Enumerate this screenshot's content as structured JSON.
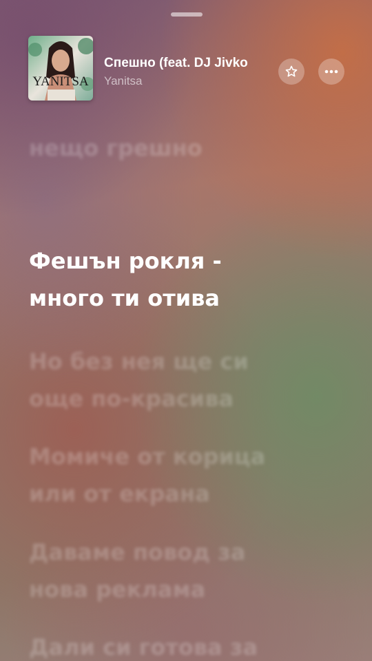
{
  "now_playing": {
    "title": "Спешно (feat. DJ Jivko",
    "artist": "Yanitsa",
    "artwork_text": "YANITSA"
  },
  "icons": {
    "favorite": "star-icon",
    "more": "more-icon"
  },
  "lyrics": {
    "past": [
      "нещо грешно"
    ],
    "current": [
      "Фешън рокля -",
      "много ти отива"
    ],
    "upcoming": [
      [
        "Но без нея ще си",
        "още по-красива"
      ],
      [
        "Момиче от корица",
        "или от екрана"
      ],
      [
        "Даваме повод за",
        "нова реклама"
      ],
      [
        "Дали си готова за"
      ]
    ]
  },
  "colors": {
    "lyric_active": "#ffffff",
    "lyric_inactive": "rgba(255,255,255,0.22)"
  }
}
